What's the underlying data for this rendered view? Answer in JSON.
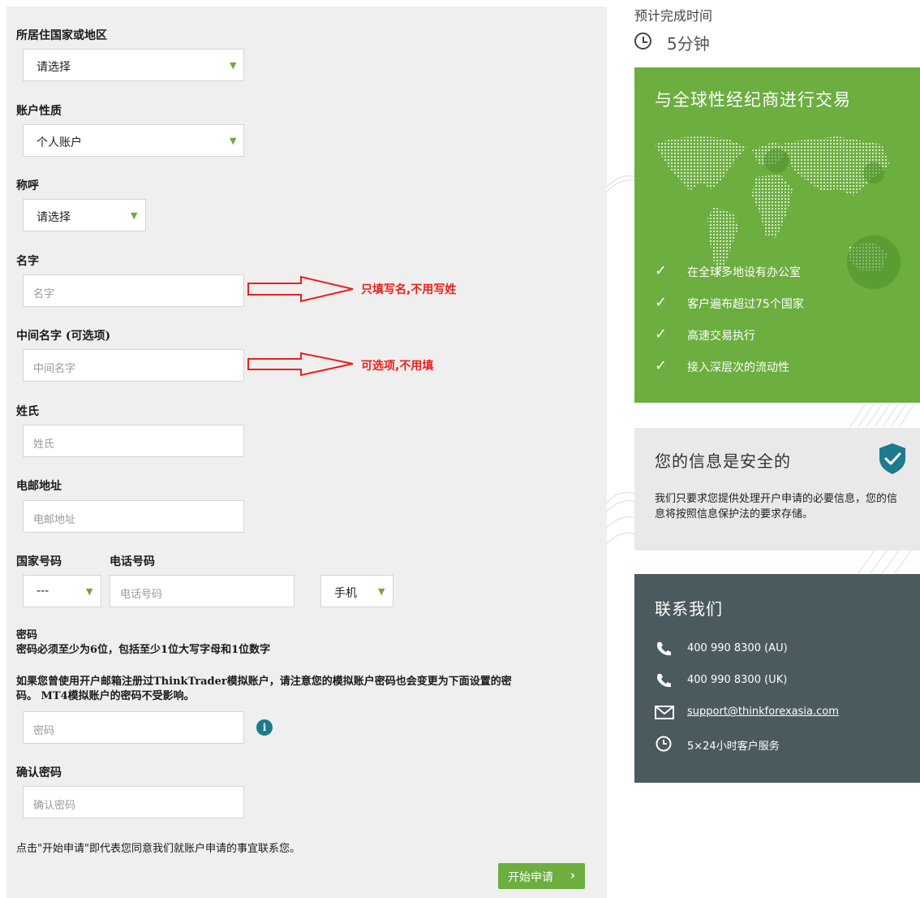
{
  "form": {
    "country_label": "所居住国家或地区",
    "country_value": "请选择",
    "account_type_label": "账户性质",
    "account_type_value": "个人账户",
    "salutation_label": "称呼",
    "salutation_value": "请选择",
    "first_name_label": "名字",
    "first_name_placeholder": "名字",
    "middle_name_label": "中间名字 (可选项)",
    "middle_name_placeholder": "中间名字",
    "last_name_label": "姓氏",
    "last_name_placeholder": "姓氏",
    "email_label": "电邮地址",
    "email_placeholder": "电邮地址",
    "country_code_label": "国家号码",
    "country_code_value": "---",
    "phone_label": "电话号码",
    "phone_placeholder": "电话号码",
    "phone_type_value": "手机",
    "password_label": "密码",
    "password_rule": "密码必须至少为6位，包括至少1位大写字母和1位数字",
    "password_notice_line1": "如果您曾使用开户邮箱注册过ThinkTrader模拟账户，请注意您的模拟账户密码也会变更为下面设置的密",
    "password_notice_line2": "码。 MT4模拟账户的密码不受影响。",
    "password_placeholder": "密码",
    "info_icon_glyph": "i",
    "confirm_password_label": "确认密码",
    "confirm_password_placeholder": "确认密码",
    "consent_text": "点击\"开始申请\"即代表您同意我们就账户申请的事宜联系您。",
    "submit_label": "开始申请",
    "submit_chevron": "›",
    "caret_glyph": "▼"
  },
  "annotations": {
    "first_name_note": "只填写名,不用写姓",
    "middle_name_note": "可选项,不用填",
    "arrow_color": "#e8201c"
  },
  "sidebar": {
    "eta_label": "预计完成时间",
    "eta_value": "5分钟",
    "global_title": "与全球性经纪商进行交易",
    "features": [
      "在全球多地设有办公室",
      "客户遍布超过75个国家",
      "高速交易执行",
      "接入深层次的流动性"
    ],
    "check_glyph": "✓",
    "secure_title": "您的信息是安全的",
    "secure_body": "我们只要求您提供处理开户申请的必要信息，您的信息将按照信息保护法的要求存储。",
    "contact_title": "联系我们",
    "contacts": [
      "400 990 8300 (AU)",
      "400 990 8300 (UK)",
      "support@thinkforexasia.com",
      "5×24小时客户服务"
    ]
  },
  "colors": {
    "brand_green": "#6cae3f",
    "contact_bg": "#4b5a5e",
    "info_teal": "#1e7a8c"
  }
}
